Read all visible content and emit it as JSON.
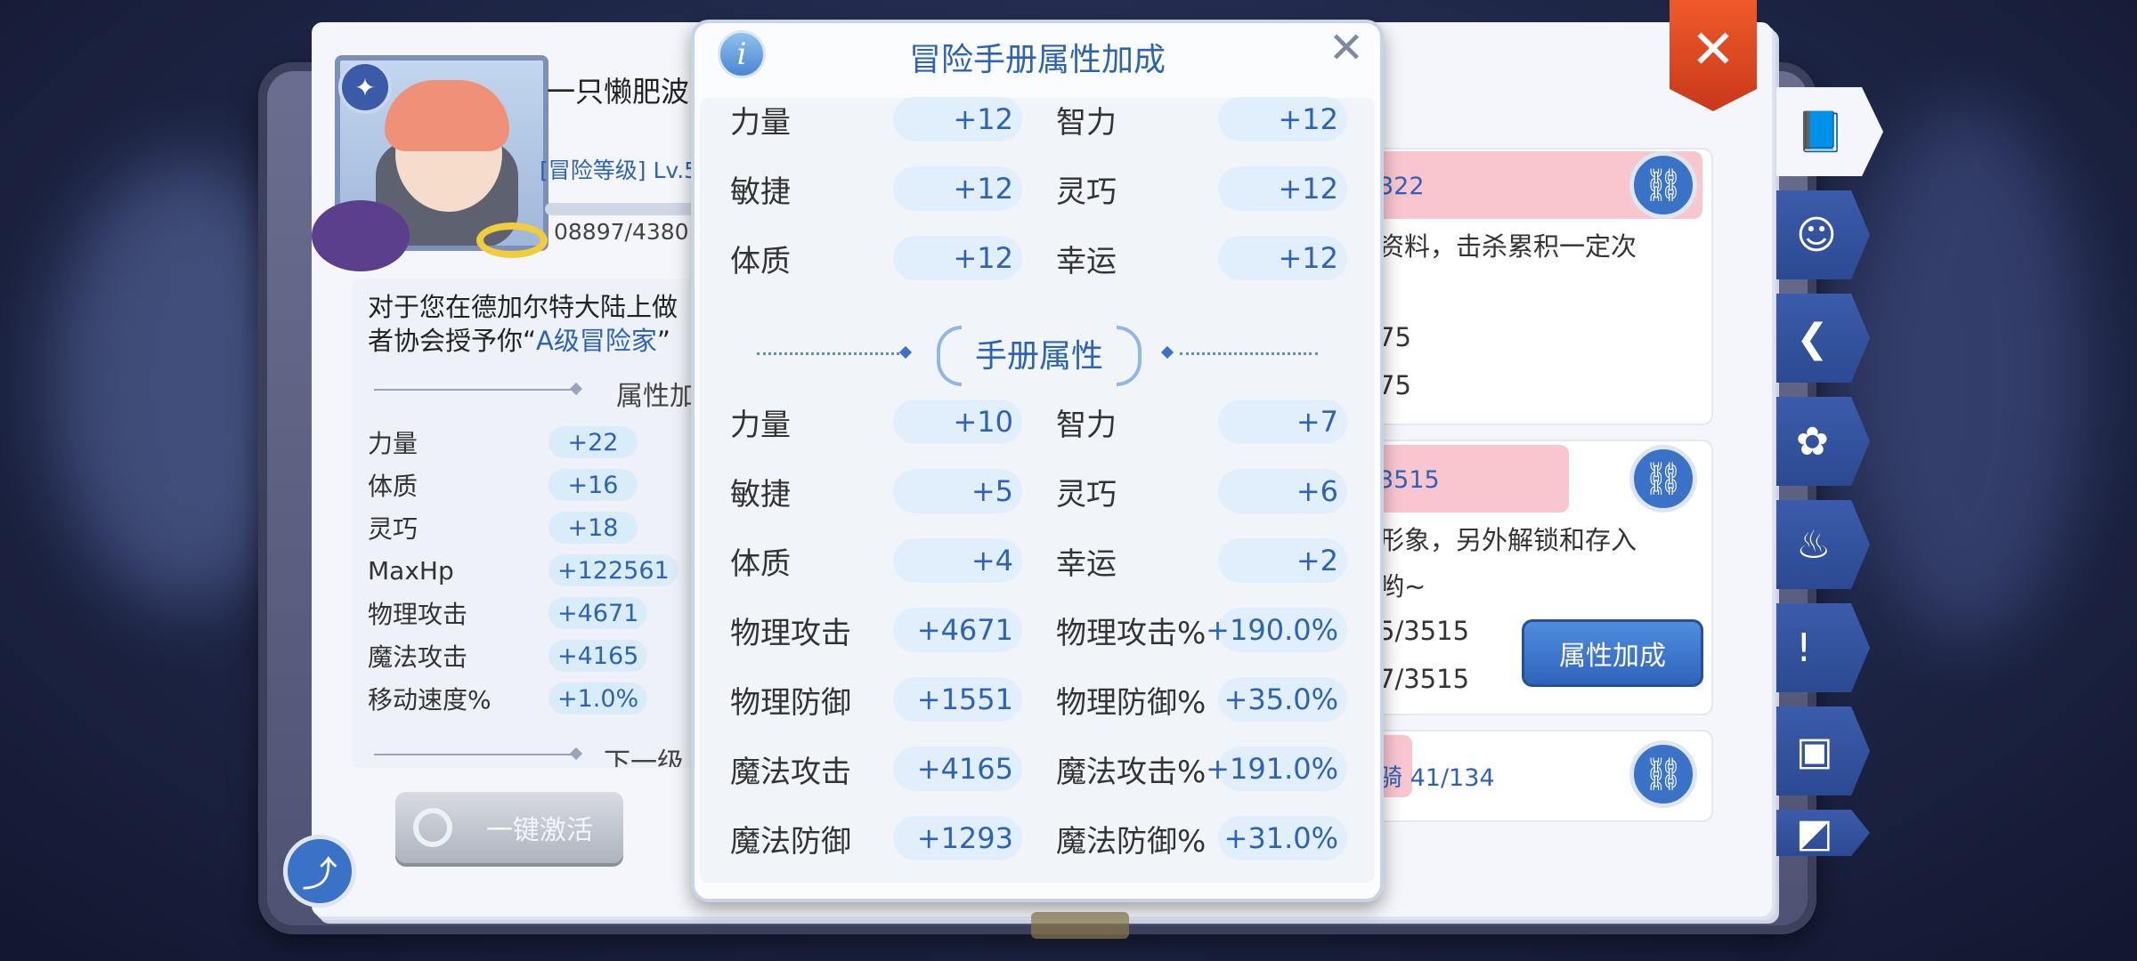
{
  "player": {
    "name": "一只懒肥波",
    "level_label": "[冒险等级] Lv.5",
    "exp_text": "08897/4380"
  },
  "description": {
    "line1": "对于您在德加尔特大陆上做",
    "line2_prefix": "者协会授予你“",
    "line2_highlight": "A级冒险家",
    "line2_suffix": "”"
  },
  "left_section_title": "属性加成",
  "left_next_title": "下一级",
  "left_stats": [
    {
      "label": "力量",
      "value": "+22"
    },
    {
      "label": "体质",
      "value": "+16"
    },
    {
      "label": "灵巧",
      "value": "+18"
    },
    {
      "label": "MaxHp",
      "value": "+122561"
    },
    {
      "label": "物理攻击",
      "value": "+4671"
    },
    {
      "label": "魔法攻击",
      "value": "+4165"
    },
    {
      "label": "移动速度%",
      "value": "+1.0%"
    }
  ],
  "activate_button": "一键激活",
  "modal": {
    "title": "冒险手册属性加成",
    "section_title": "手册属性",
    "top_rows": [
      {
        "l_label": "力量",
        "l_value": "+12",
        "r_label": "智力",
        "r_value": "+12"
      },
      {
        "l_label": "敏捷",
        "l_value": "+12",
        "r_label": "灵巧",
        "r_value": "+12"
      },
      {
        "l_label": "体质",
        "l_value": "+12",
        "r_label": "幸运",
        "r_value": "+12"
      }
    ],
    "bottom_rows": [
      {
        "l_label": "力量",
        "l_value": "+10",
        "r_label": "智力",
        "r_value": "+7"
      },
      {
        "l_label": "敏捷",
        "l_value": "+5",
        "r_label": "灵巧",
        "r_value": "+6"
      },
      {
        "l_label": "体质",
        "l_value": "+4",
        "r_label": "幸运",
        "r_value": "+2"
      },
      {
        "l_label": "物理攻击",
        "l_value": "+4671",
        "r_label": "物理攻击%",
        "r_value": "+190.0%"
      },
      {
        "l_label": "物理防御",
        "l_value": "+1551",
        "r_label": "物理防御%",
        "r_value": "+35.0%"
      },
      {
        "l_label": "魔法攻击",
        "l_value": "+4165",
        "r_label": "魔法攻击%",
        "r_value": "+191.0%"
      },
      {
        "l_label": "魔法防御",
        "l_value": "+1293",
        "r_label": "魔法防御%",
        "r_value": "+31.0%"
      }
    ]
  },
  "right_page": {
    "card1_num": "322",
    "card1_text": "资料，击杀累积一定次",
    "card1_val1": "75",
    "card1_val2": "75",
    "card2_num": "3515",
    "card2_text1": "形象，另外解锁和存入",
    "card2_text2": "哟~",
    "card2_val1": "5/3515",
    "card2_val2": "7/3515",
    "card3_num": "骑 41/134",
    "attr_button": "属性加成"
  },
  "icons": {
    "close_main": "✕",
    "close_modal": "✕",
    "info": "i",
    "share": "⤴",
    "link": "⛓"
  },
  "colors": {
    "accent_blue": "#2c63b8",
    "close_red": "#e04a22",
    "value_pill": "#e1eefb"
  }
}
